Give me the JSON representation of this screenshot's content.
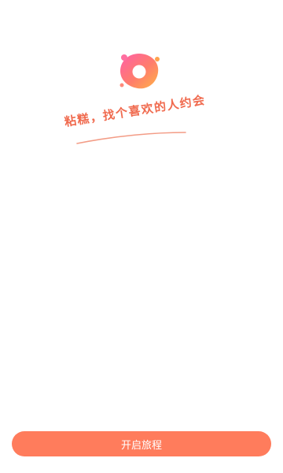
{
  "app": {
    "logo_icon": "sticky-cake-donut-logo",
    "tagline": "粘糕，找个喜欢的人约会",
    "colors": {
      "accent": "#ff7c5c",
      "tagline": "#f06a4e",
      "logo_gradient": [
        "#ff5fa8",
        "#ffb347"
      ]
    }
  },
  "actions": {
    "start_label": "开启旅程"
  }
}
